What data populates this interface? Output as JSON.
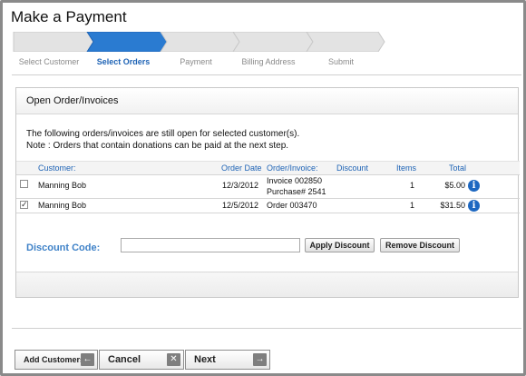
{
  "page": {
    "title": "Make a Payment"
  },
  "steps": [
    {
      "label": "Select Customer",
      "active": false
    },
    {
      "label": "Select Orders",
      "active": true
    },
    {
      "label": "Payment",
      "active": false
    },
    {
      "label": "Billing Address",
      "active": false
    },
    {
      "label": "Submit",
      "active": false
    }
  ],
  "colors": {
    "accent": "#1e63b5",
    "step_active": "#2a7bd1",
    "step_inactive": "#e3e3e3"
  },
  "panel": {
    "title": "Open Order/Invoices",
    "note_line1": "The following orders/invoices are still open for selected customer(s).",
    "note_line2": "Note : Orders that contain donations can be paid at the next step."
  },
  "table": {
    "columns": [
      "Customer:",
      "Order Date",
      "Order/Invoice:",
      "Discount",
      "Items",
      "Total"
    ],
    "rows": [
      {
        "checked": false,
        "customer": "Manning Bob",
        "date": "12/3/2012",
        "invoice": "Invoice 002850",
        "invoice_sub": "Purchase# 2541",
        "discount": "",
        "items": "1",
        "total": "$5.00"
      },
      {
        "checked": true,
        "customer": "Manning Bob",
        "date": "12/5/2012",
        "invoice": "Order 003470",
        "invoice_sub": "",
        "discount": "",
        "items": "1",
        "total": "$31.50"
      }
    ]
  },
  "discount": {
    "label": "Discount Code:",
    "value": "",
    "apply_label": "Apply Discount",
    "remove_label": "Remove Discount"
  },
  "nav": {
    "add_customers": "Add Customers",
    "cancel": "Cancel",
    "next": "Next"
  },
  "icons": {
    "info": "info-icon",
    "back": "arrow-left-icon",
    "cancel": "close-icon",
    "next": "arrow-right-icon"
  }
}
